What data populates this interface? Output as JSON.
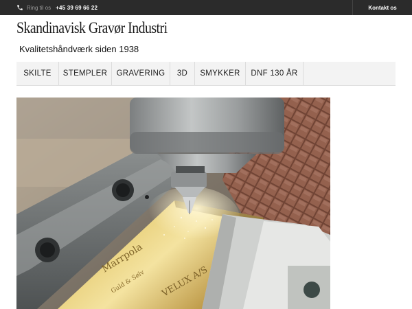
{
  "topbar": {
    "phone_icon": "phone-icon",
    "phone_label": "Ring til os",
    "phone_number": "+45 39 69 66 22",
    "contact_label": "Kontakt os"
  },
  "brand": {
    "title": "Skandinavisk Gravør Industri",
    "tagline": "Kvalitetshåndværk siden 1938"
  },
  "nav": {
    "items": [
      {
        "label": "SKILTE"
      },
      {
        "label": "STEMPLER"
      },
      {
        "label": "GRAVERING"
      },
      {
        "label": "3D"
      },
      {
        "label": "SMYKKER"
      },
      {
        "label": "DNF 130 ÅR"
      }
    ]
  },
  "hero": {
    "engraved_text_1": "Marrpola",
    "engraved_text_2": "VELUX A/S"
  },
  "colors": {
    "topbar_bg": "#2b2b2b",
    "nav_bg": "#f3f3f3"
  }
}
